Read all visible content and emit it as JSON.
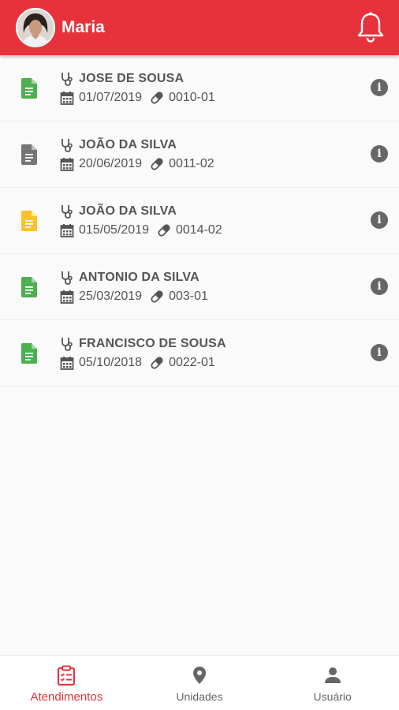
{
  "header": {
    "user_name": "Maria"
  },
  "colors": {
    "primary": "#e8323b",
    "doc_green": "#4caf50",
    "doc_gray": "#757575",
    "doc_yellow": "#fbc02d"
  },
  "appointments": [
    {
      "doctor": "JOSE DE SOUSA",
      "date": "01/07/2019",
      "code": "0010-01",
      "status_color": "green"
    },
    {
      "doctor": "JOÃO DA SILVA",
      "date": "20/06/2019",
      "code": "0011-02",
      "status_color": "gray"
    },
    {
      "doctor": "JOÃO DA SILVA",
      "date": "015/05/2019",
      "code": "0014-02",
      "status_color": "yellow"
    },
    {
      "doctor": "ANTONIO DA SILVA",
      "date": "25/03/2019",
      "code": "003-01",
      "status_color": "green"
    },
    {
      "doctor": "FRANCISCO DE SOUSA",
      "date": "05/10/2018",
      "code": "0022-01",
      "status_color": "green"
    }
  ],
  "bottom_nav": [
    {
      "label": "Atendimentos",
      "icon": "clipboard-icon",
      "active": true
    },
    {
      "label": "Unidades",
      "icon": "location-pin-icon",
      "active": false
    },
    {
      "label": "Usuário",
      "icon": "person-icon",
      "active": false
    }
  ]
}
